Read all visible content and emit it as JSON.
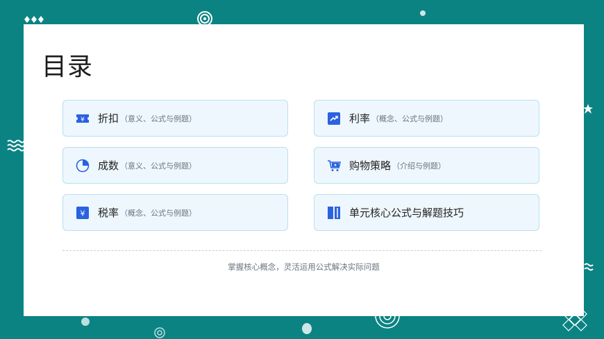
{
  "page": {
    "title": "目录"
  },
  "items": [
    {
      "icon": "ticket-yen-icon",
      "main": "折扣",
      "sub": "（意义、公式与例题）"
    },
    {
      "icon": "trend-chart-icon",
      "main": "利率",
      "sub": "（概念、公式与例题）"
    },
    {
      "icon": "pie-chart-icon",
      "main": "成数",
      "sub": "（意义、公式与例题）"
    },
    {
      "icon": "shopping-cart-icon",
      "main": "购物策略",
      "sub": "（介绍与例题）"
    },
    {
      "icon": "yen-badge-icon",
      "main": "税率",
      "sub": "（概念、公式与例题）"
    },
    {
      "icon": "book-icon",
      "main": "单元核心公式与解题技巧",
      "sub": ""
    }
  ],
  "footer": {
    "text": "掌握核心概念，灵活运用公式解决实际问题"
  },
  "colors": {
    "background": "#0b8383",
    "accent": "#2a62e0",
    "card_fill": "#eef7fd",
    "card_border": "#b9dff0"
  }
}
